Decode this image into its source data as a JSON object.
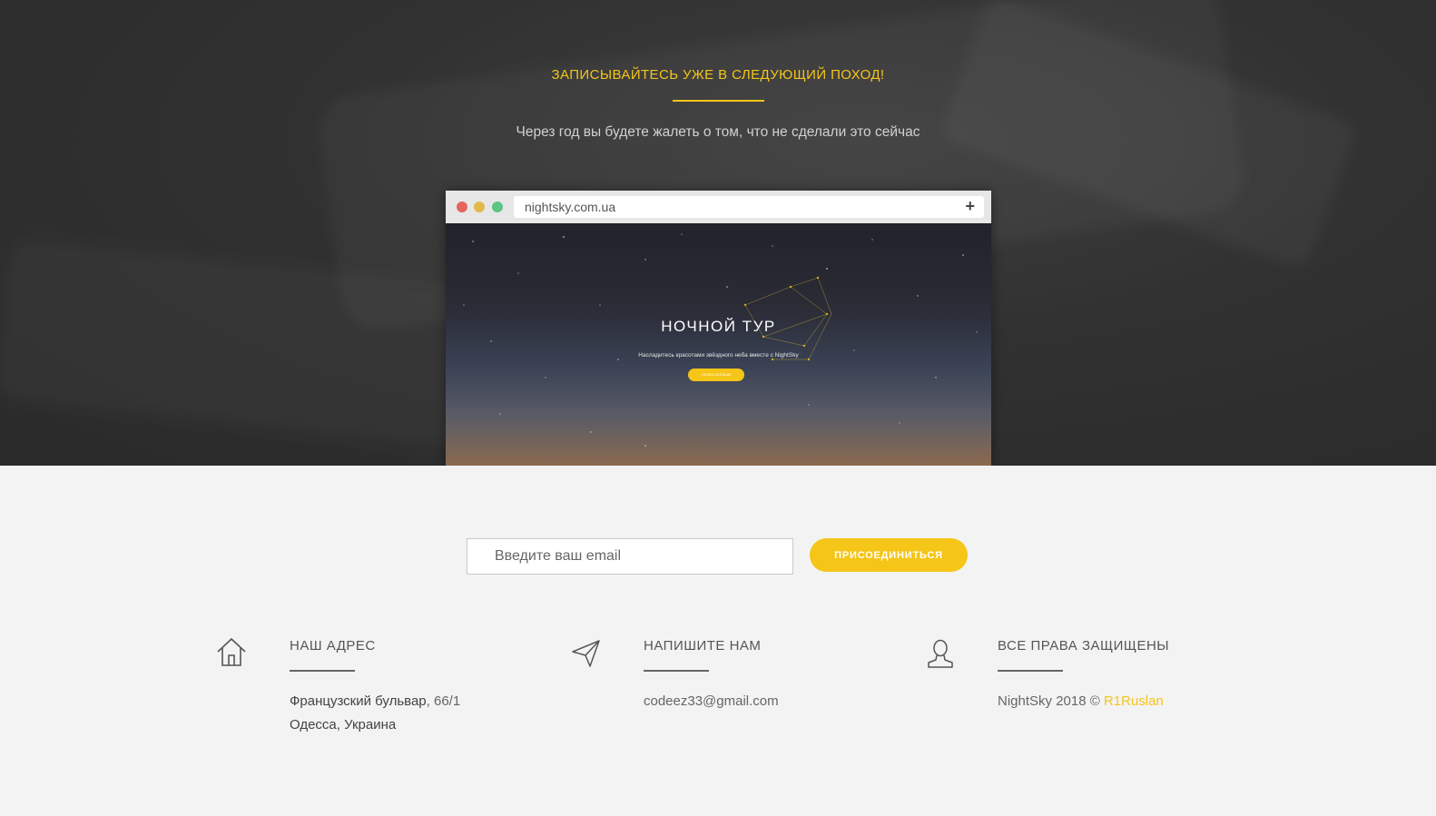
{
  "hero": {
    "title": "ЗАПИСЫВАЙТЕСЬ УЖЕ В СЛЕДУЮЩИЙ ПОХОД!",
    "subtitle": "Через год вы будете жалеть о том, что не сделали это сейчас"
  },
  "browser_mockup": {
    "url": "nightsky.com.ua",
    "new_tab_symbol": "+",
    "screen_title": "НОЧНОЙ ТУР",
    "screen_subtitle": "Насладитесь красотами звёздного неба вместе с NightSky",
    "screen_button": "УЗНАТЬ БОЛЬШЕ"
  },
  "subscribe": {
    "email_placeholder": "Введите ваш email",
    "button_label": "ПРИСОЕДИНИТЬСЯ"
  },
  "footer": {
    "address": {
      "icon": "home-icon",
      "title": "НАШ АДРЕС",
      "street": "Французский бульвар",
      "number": ", 66/1",
      "city": "Одесса, Украина"
    },
    "contact": {
      "icon": "paper-plane-icon",
      "title": "НАПИШИТЕ НАМ",
      "email": "codeez33@gmail.com"
    },
    "rights": {
      "icon": "user-icon",
      "title": "ВСЕ ПРАВА ЗАЩИЩЕНЫ",
      "copyright": "NightSky 2018 © ",
      "author": "R1Ruslan"
    }
  },
  "colors": {
    "accent": "#f5c518",
    "hero_bg": "#313131",
    "page_bg": "#f3f3f3"
  }
}
